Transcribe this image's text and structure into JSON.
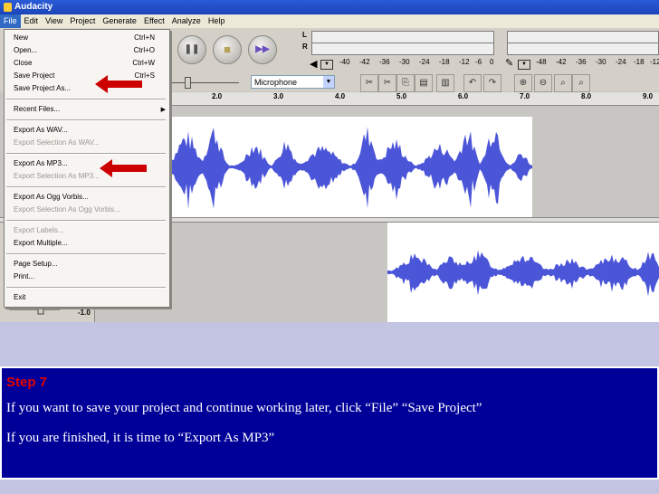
{
  "window": {
    "title": "Audacity"
  },
  "menubar": {
    "items": [
      "File",
      "Edit",
      "View",
      "Project",
      "Generate",
      "Effect",
      "Analyze",
      "Help"
    ]
  },
  "transport": {
    "pause_glyph": "❚❚",
    "stop_glyph": "■",
    "skip_glyph": "▶▶"
  },
  "meters": {
    "channel_left": "L",
    "channel_right": "R",
    "scale": [
      "-40",
      "-42",
      "-36",
      "-30",
      "-24",
      "-18",
      "-12",
      "-6",
      "0"
    ],
    "scale_right": [
      "-48",
      "-42",
      "-36",
      "-30",
      "-24",
      "-18",
      "-12"
    ]
  },
  "input_source": {
    "value": "Microphone"
  },
  "ruler": {
    "ticks": [
      "2.0",
      "3.0",
      "4.0",
      "5.0",
      "6.0",
      "7.0",
      "8.0",
      "9.0"
    ]
  },
  "track": {
    "gain_value": "-1.0"
  },
  "file_menu": {
    "groups": [
      [
        {
          "label": "New",
          "shortcut": "Ctrl+N",
          "enabled": true
        },
        {
          "label": "Open...",
          "shortcut": "Ctrl+O",
          "enabled": true
        },
        {
          "label": "Close",
          "shortcut": "Ctrl+W",
          "enabled": true
        },
        {
          "label": "Save Project",
          "shortcut": "Ctrl+S",
          "enabled": true
        },
        {
          "label": "Save Project As...",
          "shortcut": "",
          "enabled": true
        }
      ],
      [
        {
          "label": "Recent Files...",
          "shortcut": "",
          "enabled": true,
          "submenu": true
        }
      ],
      [
        {
          "label": "Export As WAV...",
          "shortcut": "",
          "enabled": true
        },
        {
          "label": "Export Selection As WAV...",
          "shortcut": "",
          "enabled": false
        }
      ],
      [
        {
          "label": "Export As MP3...",
          "shortcut": "",
          "enabled": true
        },
        {
          "label": "Export Selection As MP3...",
          "shortcut": "",
          "enabled": false
        }
      ],
      [
        {
          "label": "Export As Ogg Vorbis...",
          "shortcut": "",
          "enabled": true
        },
        {
          "label": "Export Selection As Ogg Vorbis...",
          "shortcut": "",
          "enabled": false
        }
      ],
      [
        {
          "label": "Export Labels...",
          "shortcut": "",
          "enabled": false
        },
        {
          "label": "Export Multiple...",
          "shortcut": "",
          "enabled": true
        }
      ],
      [
        {
          "label": "Page Setup...",
          "shortcut": "",
          "enabled": true
        },
        {
          "label": "Print...",
          "shortcut": "",
          "enabled": true
        }
      ],
      [
        {
          "label": "Exit",
          "shortcut": "",
          "enabled": true
        }
      ]
    ]
  },
  "instructions": {
    "step": "Step 7",
    "line1": "If you want to save your project and continue working later, click “File” “Save Project”",
    "line2": "If you are finished, it is time to “Export As MP3”"
  },
  "colors": {
    "accent_blue": "#000099",
    "arrow_red": "#cc0000",
    "wave": "#4b55d8",
    "step_red": "#e30000"
  }
}
